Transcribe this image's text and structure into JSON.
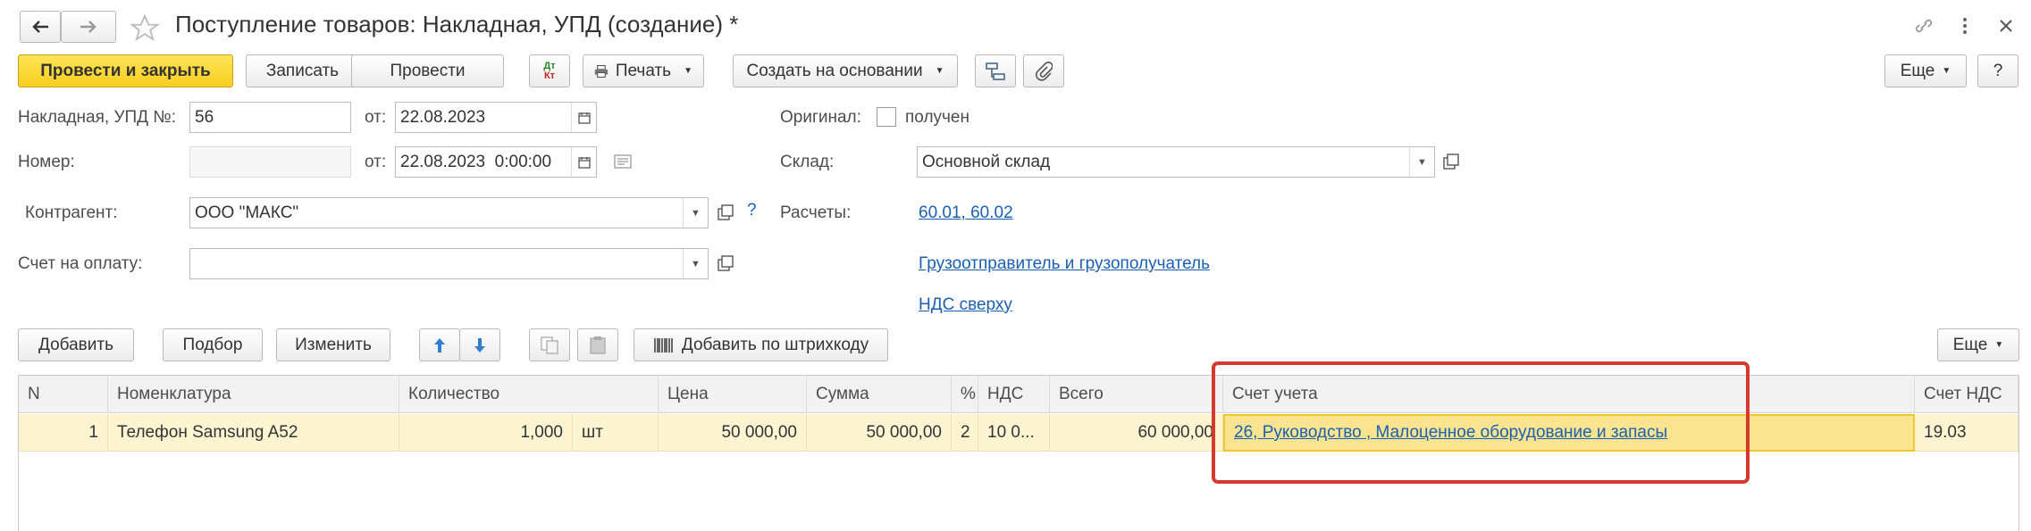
{
  "window": {
    "title": "Поступление товаров: Накладная, УПД (создание) *"
  },
  "toolbar": {
    "post_close": "Провести и закрыть",
    "save": "Записать",
    "post": "Провести",
    "dtkt_top": "Дт",
    "dtkt_bottom": "Кт",
    "print": "Печать",
    "create_based": "Создать на основании",
    "more": "Еще",
    "help": "?"
  },
  "form": {
    "invoice_label": "Накладная, УПД №:",
    "invoice_number": "56",
    "from_label1": "от:",
    "date1": "22.08.2023",
    "number_label": "Номер:",
    "number_value": "",
    "from_label2": "от:",
    "date2": "22.08.2023  0:00:00",
    "counterparty_label": "Контрагент:",
    "counterparty_value": "ООО \"МАКС\"",
    "counterparty_help": "?",
    "payment_label": "Счет на оплату:",
    "payment_value": "",
    "original_label": "Оригинал:",
    "received_label": "получен",
    "warehouse_label": "Склад:",
    "warehouse_value": "Основной склад",
    "settlements_label": "Расчеты:",
    "settlements_link": "60.01, 60.02",
    "shipper_link": "Грузоотправитель и грузополучатель",
    "vat_link": "НДС сверху"
  },
  "table_toolbar": {
    "add": "Добавить",
    "select": "Подбор",
    "change": "Изменить",
    "add_barcode": "Добавить по штрихкоду",
    "more": "Еще"
  },
  "table": {
    "headers": {
      "n": "N",
      "nomenclature": "Номенклатура",
      "quantity": "Количество",
      "price": "Цена",
      "sum": "Сумма",
      "pct": "%",
      "vat": "НДС",
      "total": "Всего",
      "account": "Счет учета",
      "vat_account": "Счет НДС"
    },
    "rows": [
      {
        "n": "1",
        "nomenclature": "Телефон Samsung A52",
        "quantity": "1,000",
        "unit": "шт",
        "price": "50 000,00",
        "sum": "50 000,00",
        "pct": "2",
        "vat": "10 0...",
        "total": "60 000,00",
        "account": "26, Руководство , Малоценное оборудование и запасы",
        "vat_account": "19.03"
      }
    ]
  },
  "colors": {
    "primary_button": "#f7cf20",
    "row_highlight": "#fdf5d2",
    "active_cell": "#fbe48f",
    "annotation_red": "#d63a2f",
    "link": "#1a5fb4"
  }
}
